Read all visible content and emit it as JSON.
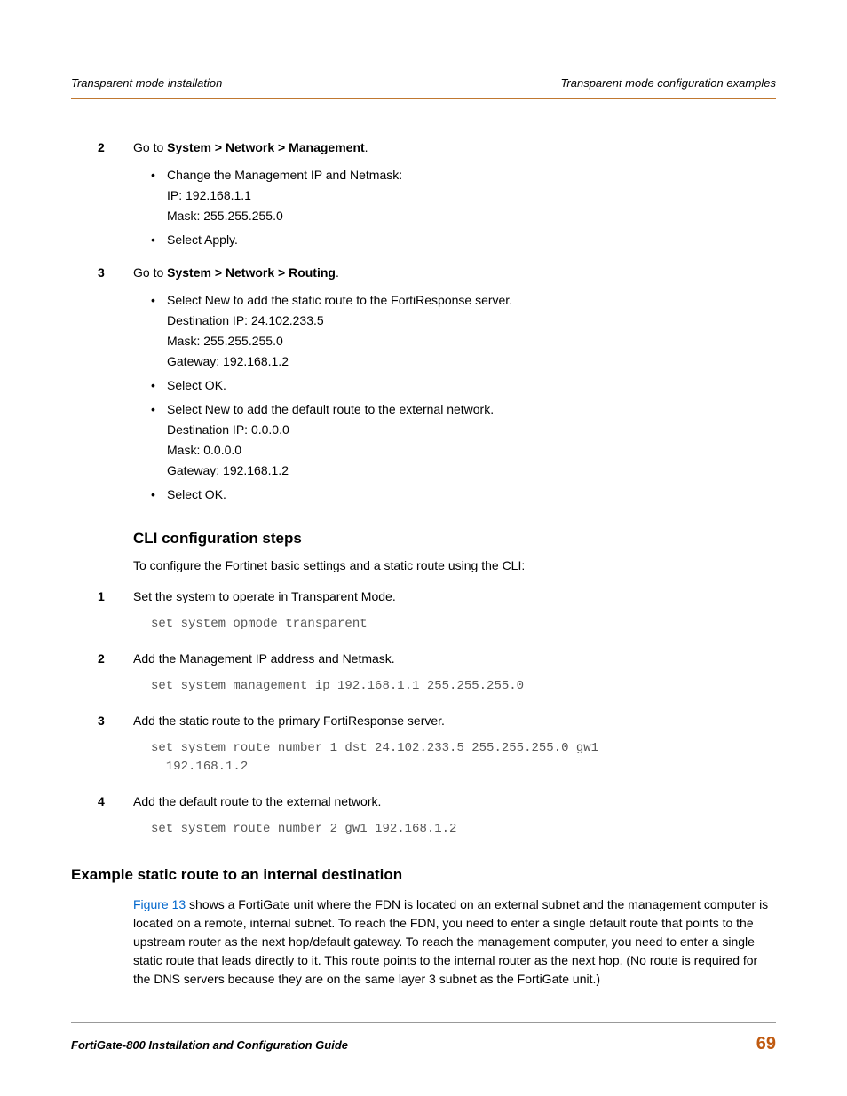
{
  "header": {
    "left": "Transparent mode installation",
    "right": "Transparent mode configuration examples"
  },
  "steps": {
    "s2": {
      "num": "2",
      "lead": "Go to ",
      "path": "System > Network > Management",
      "tail": ".",
      "bullets": [
        {
          "text": "Change the Management IP and Netmask:",
          "lines": [
            "IP: 192.168.1.1",
            "Mask: 255.255.255.0"
          ]
        },
        {
          "text": "Select Apply."
        }
      ]
    },
    "s3": {
      "num": "3",
      "lead": "Go to ",
      "path": "System > Network > Routing",
      "tail": ".",
      "bullets": [
        {
          "text": "Select New to add the static route to the FortiResponse server.",
          "lines": [
            "Destination IP: 24.102.233.5",
            "Mask: 255.255.255.0",
            "Gateway: 192.168.1.2"
          ]
        },
        {
          "text": "Select OK."
        },
        {
          "text": "Select New to add the default route to the external network.",
          "lines": [
            "Destination IP: 0.0.0.0",
            "Mask: 0.0.0.0",
            "Gateway: 192.168.1.2"
          ]
        },
        {
          "text": "Select OK."
        }
      ]
    }
  },
  "cli": {
    "heading": "CLI configuration steps",
    "intro": "To configure the Fortinet basic settings and a static route using the CLI:",
    "items": [
      {
        "num": "1",
        "text": "Set the system to operate in Transparent Mode.",
        "code": "set system opmode transparent"
      },
      {
        "num": "2",
        "text": "Add the Management IP address and Netmask.",
        "code": "set system management ip 192.168.1.1 255.255.255.0"
      },
      {
        "num": "3",
        "text": "Add the static route to the primary FortiResponse server.",
        "code": "set system route number 1 dst 24.102.233.5 255.255.255.0 gw1\n  192.168.1.2"
      },
      {
        "num": "4",
        "text": "Add the default route to the external network.",
        "code": "set system route number 2 gw1 192.168.1.2"
      }
    ]
  },
  "section": {
    "heading": "Example static route to an internal destination",
    "figref": "Figure 13",
    "para_rest": " shows a FortiGate unit where the FDN is located on an external subnet and the management computer is located on a remote, internal subnet. To reach the FDN, you need to enter a single default route that points to the upstream router as the next hop/default gateway. To reach the management computer, you need to enter a single static route that leads directly to it. This route points to the internal router as the next hop. (No route is required for the DNS servers because they are on the same layer 3 subnet as the FortiGate unit.)"
  },
  "footer": {
    "doc": "FortiGate-800 Installation and Configuration Guide",
    "page": "69"
  }
}
